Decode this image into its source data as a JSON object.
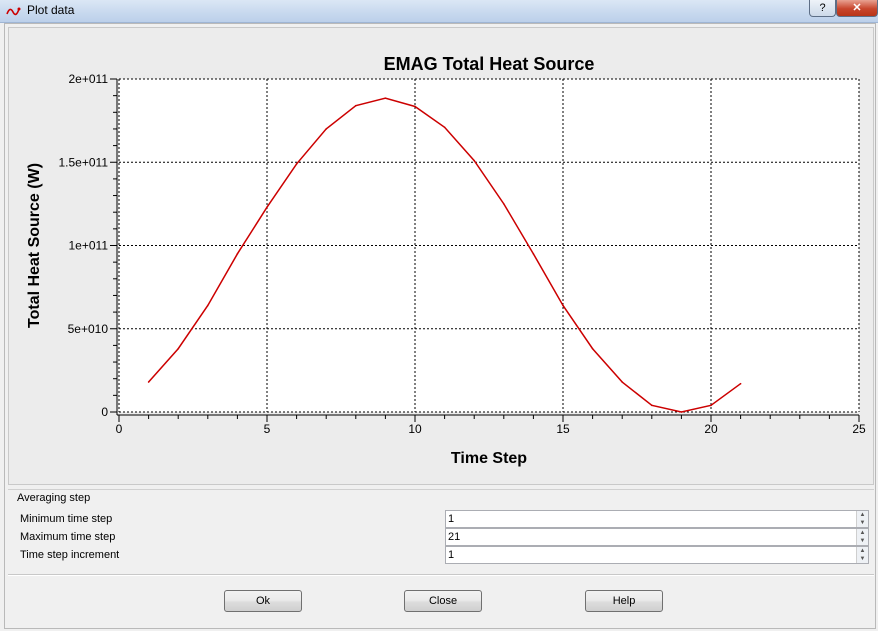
{
  "window": {
    "title": "Plot data",
    "help_label": "?",
    "close_label": "✕"
  },
  "chart_data": {
    "type": "line",
    "title": "EMAG Total Heat Source",
    "xlabel": "Time Step",
    "ylabel": "Total Heat Source (W)",
    "xlim": [
      0,
      25
    ],
    "ylim": [
      0,
      200000000000.0
    ],
    "x_ticks": [
      0,
      5,
      10,
      15,
      20,
      25
    ],
    "y_ticks": [
      0,
      50000000000.0,
      100000000000.0,
      150000000000.0,
      200000000000.0
    ],
    "x_tick_labels": [
      "0",
      "5",
      "10",
      "15",
      "20",
      "25"
    ],
    "y_tick_labels": [
      "0",
      "5e+010",
      "1e+011",
      "1.5e+011",
      "2e+011"
    ],
    "grid": true,
    "line_color": "#cc0000",
    "series": [
      {
        "x": [
          1,
          2,
          3,
          4,
          5,
          6,
          7,
          8,
          9,
          10,
          11,
          12,
          13,
          14,
          15,
          16,
          17,
          18,
          19,
          20,
          21
        ],
        "values": [
          18000000000.0,
          38000000000.0,
          64000000000.0,
          95000000000.0,
          123000000000.0,
          149000000000.0,
          170000000000.0,
          184000000000.0,
          188500000000.0,
          183500000000.0,
          171000000000.0,
          151000000000.0,
          125000000000.0,
          95000000000.0,
          64000000000.0,
          38000000000.0,
          18000000000.0,
          4000000000.0,
          0,
          4000000000.0,
          17000000000.0
        ]
      }
    ]
  },
  "averaging": {
    "group_title": "Averaging step",
    "min_label": "Minimum time step",
    "min_value": "1",
    "max_label": "Maximum time step",
    "max_value": "21",
    "inc_label": "Time step increment",
    "inc_value": "1"
  },
  "buttons": {
    "ok": "Ok",
    "close": "Close",
    "help": "Help"
  }
}
